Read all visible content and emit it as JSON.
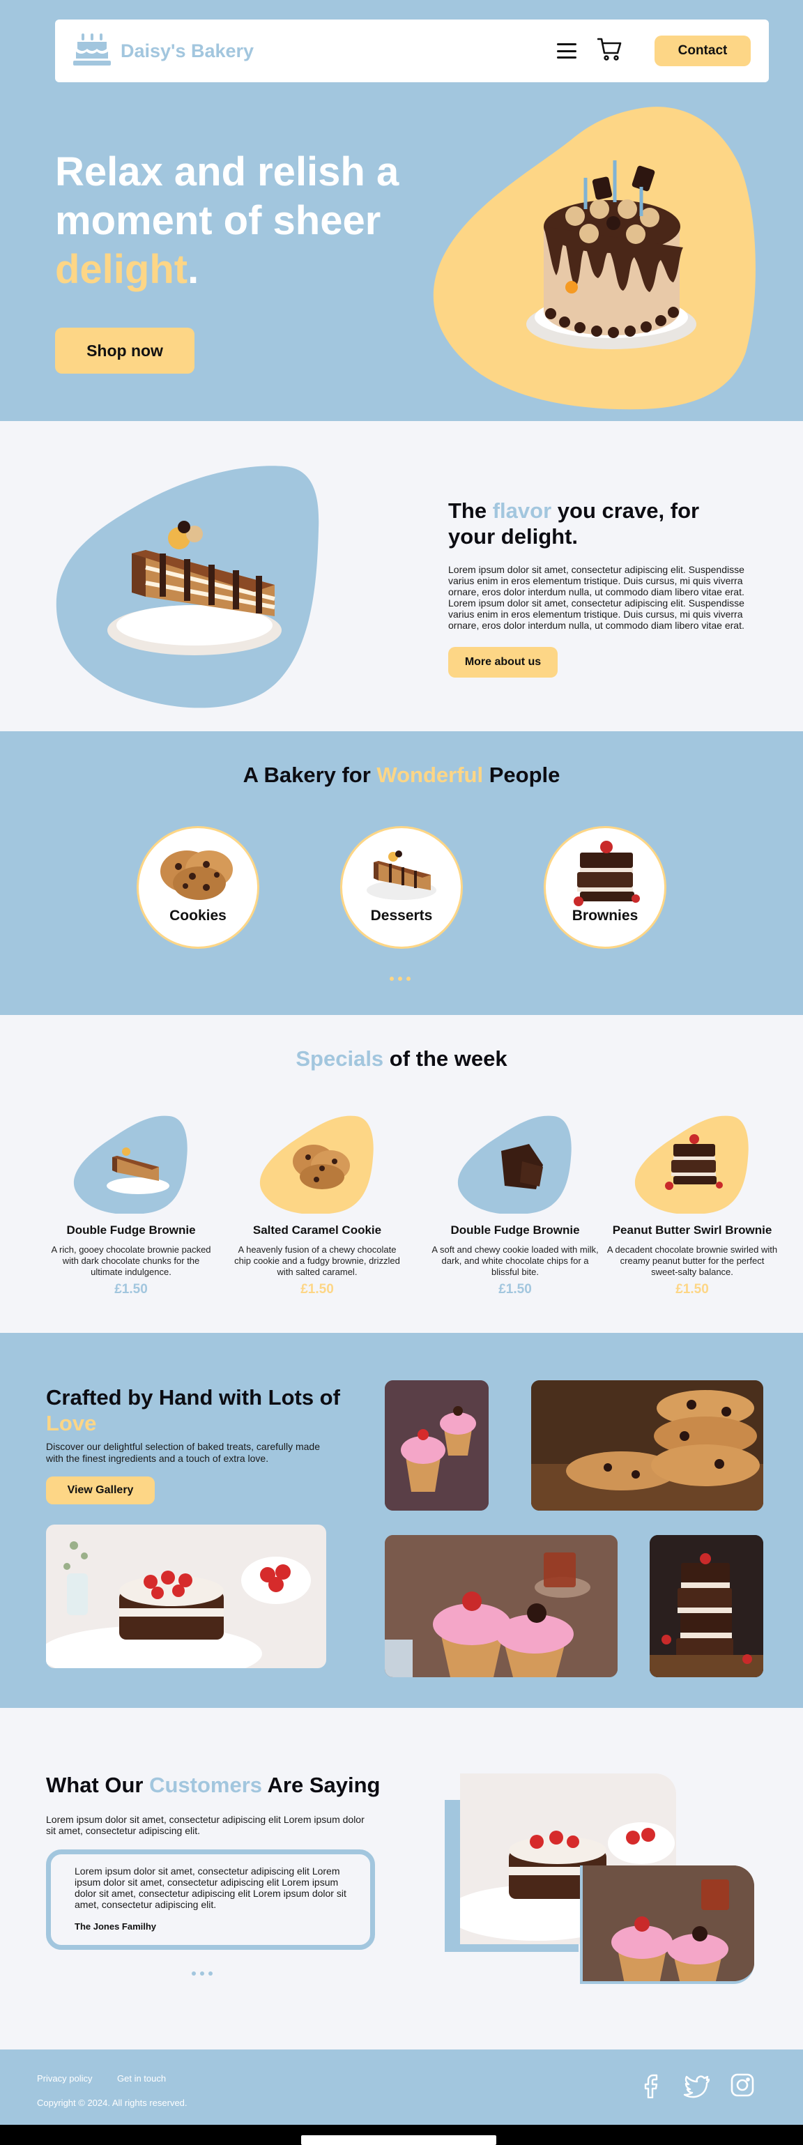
{
  "colors": {
    "accent_blue": "#a2c6de",
    "accent_yellow": "#fdd686",
    "text_dark": "#0c0c12",
    "page_bg": "#f4f5f9"
  },
  "header": {
    "brand_name": "Daisy's Bakery",
    "logo_icon": "cake-icon",
    "menu_icon": "hamburger-icon",
    "cart_icon": "cart-icon",
    "contact_label": "Contact"
  },
  "hero": {
    "title_line1": "Relax and relish a",
    "title_line2": "moment of sheer",
    "title_highlight": "delight",
    "title_end": ".",
    "cta_label": "Shop now"
  },
  "about": {
    "title_pre": "The ",
    "title_highlight": "flavor",
    "title_post": " you crave, for your delight.",
    "body": "Lorem ipsum dolor sit amet, consectetur adipiscing elit. Suspendisse varius enim in eros elementum tristique. Duis cursus, mi quis viverra ornare, eros dolor interdum nulla, ut commodo diam libero vitae erat. Lorem ipsum dolor sit amet, consectetur adipiscing elit. Suspendisse varius enim in eros elementum tristique. Duis cursus, mi quis viverra ornare, eros dolor interdum nulla, ut commodo diam libero vitae erat.",
    "cta_label": "More about us"
  },
  "categories": {
    "title_pre": "A Bakery for ",
    "title_highlight": "Wonderful",
    "title_post": " People",
    "items": [
      {
        "label": "Cookies",
        "icon": "cookies-image"
      },
      {
        "label": "Desserts",
        "icon": "cake-slice-image"
      },
      {
        "label": "Brownies",
        "icon": "brownies-image"
      }
    ]
  },
  "specials": {
    "title_highlight": "Specials",
    "title_post": " of the week",
    "items": [
      {
        "name": "Double Fudge Brownie",
        "desc": "A rich, gooey chocolate brownie packed with dark chocolate chunks for the ultimate indulgence.",
        "price": "£1.50",
        "accent": "#a2c6de"
      },
      {
        "name": "Salted Caramel Cookie",
        "desc": "A heavenly fusion of a chewy chocolate chip cookie and a fudgy brownie, drizzled with salted caramel.",
        "price": "£1.50",
        "accent": "#fdd686"
      },
      {
        "name": "Double Fudge Brownie",
        "desc": "A soft and chewy cookie loaded with milk, dark, and white chocolate chips for a blissful bite.",
        "price": "£1.50",
        "accent": "#a2c6de"
      },
      {
        "name": "Peanut Butter Swirl Brownie",
        "desc": "A decadent chocolate brownie swirled with creamy peanut butter for the perfect sweet-salty balance.",
        "price": "£1.50",
        "accent": "#fdd686"
      }
    ]
  },
  "gallery": {
    "title_pre": "Crafted by Hand with Lots of ",
    "title_highlight": "Love",
    "body": "Discover our delightful selection of baked treats, carefully made with the finest ingredients and a touch of extra love.",
    "cta_label": "View Gallery"
  },
  "testimonials": {
    "title_pre": "What Our ",
    "title_highlight": "Customers",
    "title_post": " Are Saying",
    "intro": "Lorem ipsum dolor sit amet, consectetur adipiscing elit Lorem ipsum dolor sit amet, consectetur adipiscing elit.",
    "quote": "Lorem ipsum dolor sit amet, consectetur adipiscing elit Lorem ipsum dolor sit amet, consectetur adipiscing elit Lorem ipsum dolor sit amet, consectetur adipiscing elit Lorem ipsum dolor sit amet, consectetur adipiscing elit.",
    "author": "The Jones Familhy"
  },
  "footer": {
    "privacy_label": "Privacy policy",
    "contact_label": "Get in touch",
    "copyright": "Copyright © 2024. All rights reserved.",
    "social_icons": [
      "facebook-icon",
      "twitter-icon",
      "instagram-icon"
    ]
  }
}
